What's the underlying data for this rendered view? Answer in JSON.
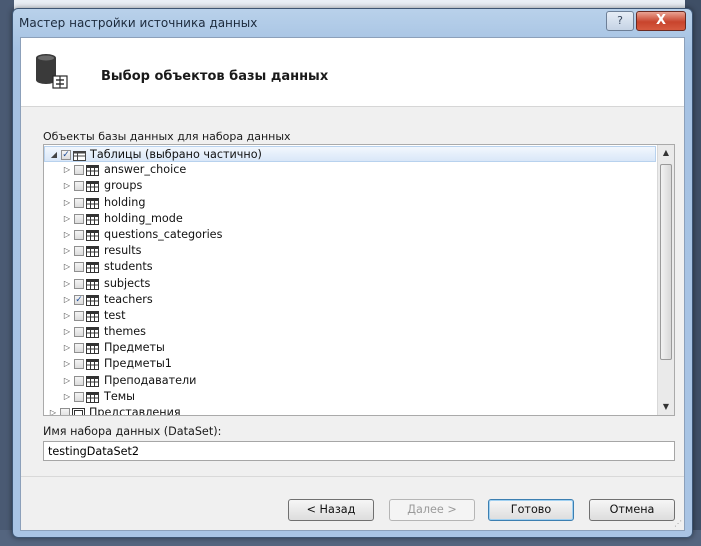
{
  "window": {
    "title": "Мастер настройки источника данных",
    "help_label": "?",
    "close_label": "X"
  },
  "header": {
    "title": "Выбор объектов базы данных"
  },
  "tree": {
    "label": "Объекты базы данных для набора данных",
    "root": {
      "label": "Таблицы (выбрано частично)",
      "checked": true
    },
    "tables": [
      {
        "label": "answer_choice",
        "checked": false
      },
      {
        "label": "groups",
        "checked": false
      },
      {
        "label": "holding",
        "checked": false
      },
      {
        "label": "holding_mode",
        "checked": false
      },
      {
        "label": "questions_categories",
        "checked": false
      },
      {
        "label": "results",
        "checked": false
      },
      {
        "label": "students",
        "checked": false
      },
      {
        "label": "subjects",
        "checked": false
      },
      {
        "label": "teachers",
        "checked": true
      },
      {
        "label": "test",
        "checked": false
      },
      {
        "label": "themes",
        "checked": false
      },
      {
        "label": "Предметы",
        "checked": false
      },
      {
        "label": "Предметы1",
        "checked": false
      },
      {
        "label": "Преподаватели",
        "checked": false
      },
      {
        "label": "Темы",
        "checked": false
      }
    ],
    "views": {
      "label": "Представления",
      "checked": false
    }
  },
  "dataset": {
    "label": "Имя набора данных (DataSet):",
    "value": "testingDataSet2"
  },
  "buttons": {
    "back": "< Назад",
    "next": "Далее >",
    "finish": "Готово",
    "cancel": "Отмена"
  },
  "colors": {
    "accent": "#3c7fb1",
    "close": "#c8442d",
    "selection": "#d9e7f8"
  }
}
